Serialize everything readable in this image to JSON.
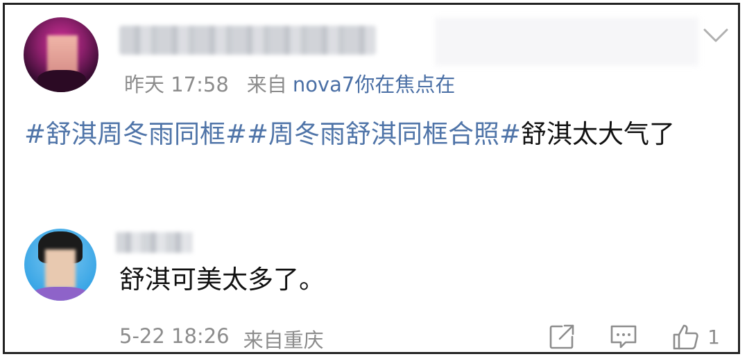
{
  "post": {
    "time": "昨天 17:58",
    "from_label": "来自",
    "device": "nova7你在焦点在",
    "content_segments": [
      {
        "text": "#舒淇周冬雨同框#",
        "type": "hashtag"
      },
      {
        "text": "#周冬雨舒淇同框合照#",
        "type": "hashtag"
      },
      {
        "text": "舒淇太大气了",
        "type": "text"
      }
    ]
  },
  "comment": {
    "text": "舒淇可美太多了。",
    "time": "5-22 18:26",
    "from": "来自重庆",
    "like_count": "1"
  },
  "colors": {
    "hashtag": "#4f74a8",
    "meta": "#8c8c8c",
    "text": "#111111"
  },
  "icons": [
    "chevron-down-icon",
    "repost-icon",
    "comment-icon",
    "like-icon"
  ]
}
